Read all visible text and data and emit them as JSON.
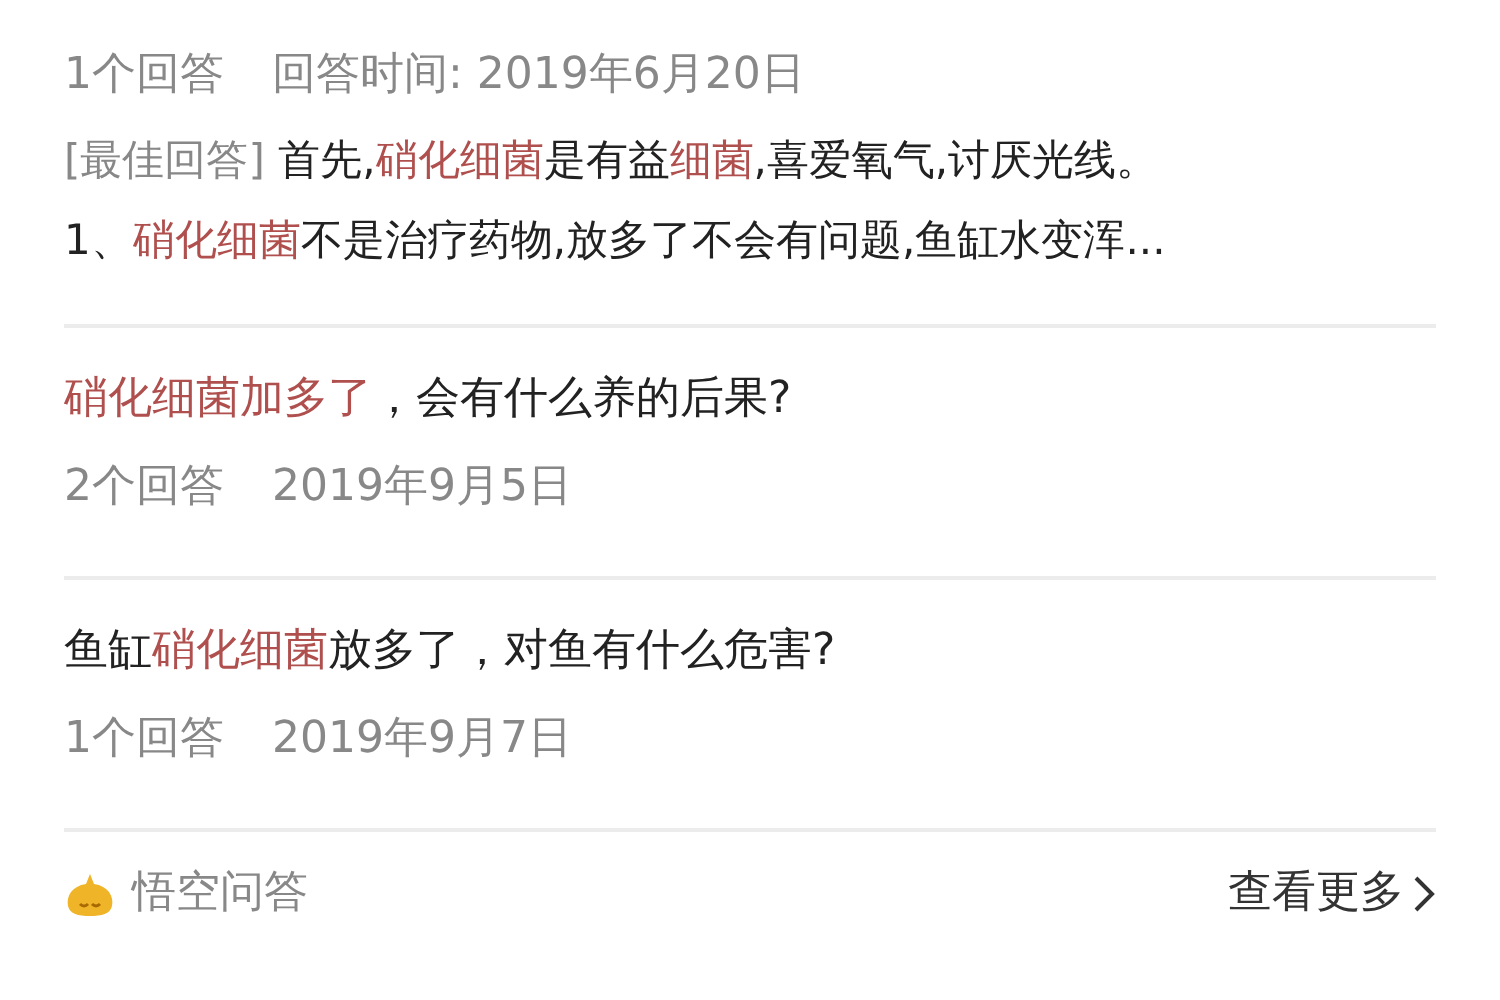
{
  "results": [
    {
      "meta": [
        {
          "text": "1个回答"
        },
        {
          "text": "回答时间: 2019年6月20日"
        }
      ],
      "answer_lines": [
        {
          "label": "[最佳回答]",
          "segments": [
            {
              "text": " 首先,",
              "highlight": false
            },
            {
              "text": "硝化细菌",
              "highlight": true
            },
            {
              "text": "是有益",
              "highlight": false
            },
            {
              "text": "细菌",
              "highlight": true
            },
            {
              "text": ",喜爱氧气,讨厌光线。",
              "highlight": false
            }
          ]
        },
        {
          "segments": [
            {
              "text": "1、",
              "highlight": false
            },
            {
              "text": "硝化细菌",
              "highlight": true
            },
            {
              "text": "不是治疗药物,放多了不会有问题,鱼缸水变浑...",
              "highlight": false
            }
          ]
        }
      ]
    },
    {
      "title": [
        {
          "text": "硝化细菌加多了",
          "highlight": true
        },
        {
          "text": "，会有什么养的后果?",
          "highlight": false
        }
      ],
      "meta": [
        {
          "text": "2个回答"
        },
        {
          "text": "2019年9月5日"
        }
      ]
    },
    {
      "title": [
        {
          "text": "鱼缸",
          "highlight": false
        },
        {
          "text": "硝化细菌",
          "highlight": true
        },
        {
          "text": "放多了，对鱼有什么危害?",
          "highlight": false
        }
      ],
      "meta": [
        {
          "text": "1个回答"
        },
        {
          "text": "2019年9月7日"
        }
      ]
    }
  ],
  "footer": {
    "brand": "悟空问答",
    "more": "查看更多"
  }
}
